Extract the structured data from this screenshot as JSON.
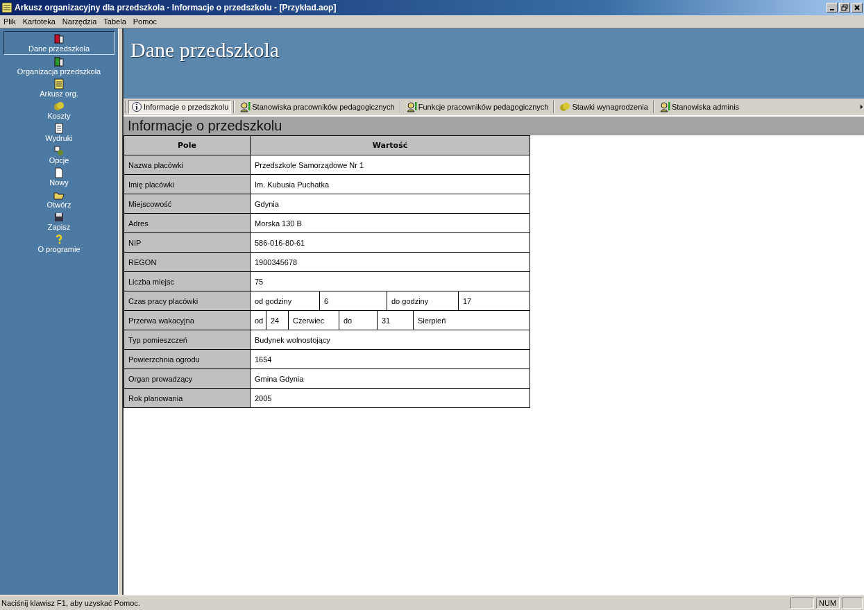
{
  "window": {
    "title": "Arkusz organizacyjny dla przedszkola - Informacje o przedszkolu - [Przykład.aop]"
  },
  "menu": [
    {
      "label": "Plik"
    },
    {
      "label": "Kartoteka"
    },
    {
      "label": "Narzędzia"
    },
    {
      "label": "Tabela"
    },
    {
      "label": "Pomoc"
    }
  ],
  "sidebar": {
    "items": [
      {
        "label": "Dane przedszkola",
        "selected": true,
        "kind": "book-red"
      },
      {
        "label": "Organizacja przedszkola",
        "selected": false,
        "kind": "book-green"
      },
      {
        "label": "Arkusz org.",
        "selected": false,
        "kind": "note"
      },
      {
        "label": "Koszty",
        "selected": false,
        "kind": "coins"
      },
      {
        "label": "Wydruki",
        "selected": false,
        "kind": "page"
      },
      {
        "label": "Opcje",
        "selected": false,
        "kind": "options"
      },
      {
        "label": "Nowy",
        "selected": false,
        "kind": "blank"
      },
      {
        "label": "Otwórz",
        "selected": false,
        "kind": "folder"
      },
      {
        "label": "Zapisz",
        "selected": false,
        "kind": "disk"
      },
      {
        "label": "O programie",
        "selected": false,
        "kind": "help"
      }
    ]
  },
  "header": {
    "title": "Dane przedszkola"
  },
  "tabs": [
    {
      "label": "Informacje o przedszkolu",
      "selected": true,
      "kind": "info"
    },
    {
      "label": "Stanowiska pracowników pedagogicznych",
      "selected": false,
      "kind": "person"
    },
    {
      "label": "Funkcje pracowników pedagogicznych",
      "selected": false,
      "kind": "person"
    },
    {
      "label": "Stawki wynagrodzenia",
      "selected": false,
      "kind": "coins"
    },
    {
      "label": "Stanowiska adminis",
      "selected": false,
      "kind": "person"
    }
  ],
  "section": {
    "title": "Informacje o przedszkolu"
  },
  "table": {
    "headings": {
      "field": "Pole",
      "value": "Wartość"
    },
    "rows": [
      {
        "kind": "plain",
        "field": "Nazwa placówki",
        "value": "Przedszkole Samorządowe Nr 1"
      },
      {
        "kind": "plain",
        "field": "Imię placówki",
        "value": "Im. Kubusia Puchatka"
      },
      {
        "kind": "plain",
        "field": "Miejscowość",
        "value": "Gdynia"
      },
      {
        "kind": "plain",
        "field": "Adres",
        "value": "Morska 130 B"
      },
      {
        "kind": "plain",
        "field": "NIP",
        "value": "586-016-80-61"
      },
      {
        "kind": "plain",
        "field": "REGON",
        "value": "1900345678"
      },
      {
        "kind": "plain",
        "field": "Liczba miejsc",
        "value": "75"
      },
      {
        "kind": "hours",
        "field": "Czas pracy placówki",
        "parts": [
          "od godziny",
          "6",
          "do godziny",
          "17"
        ]
      },
      {
        "kind": "holiday",
        "field": "Przerwa wakacyjna",
        "parts": [
          "od",
          "24",
          "Czerwiec",
          "do",
          "31",
          "Sierpień"
        ]
      },
      {
        "kind": "plain",
        "field": "Typ pomieszczeń",
        "value": "Budynek wolnostojący"
      },
      {
        "kind": "plain",
        "field": "Powierzchnia ogrodu",
        "value": "1654"
      },
      {
        "kind": "plain",
        "field": "Organ prowadzący",
        "value": "Gmina Gdynia"
      },
      {
        "kind": "plain",
        "field": "Rok planowania",
        "value": "2005"
      }
    ]
  },
  "status_bar": {
    "text": "Naciśnij klawisz F1, aby uzyskać Pomoc.",
    "indicators": [
      "NUM"
    ]
  }
}
